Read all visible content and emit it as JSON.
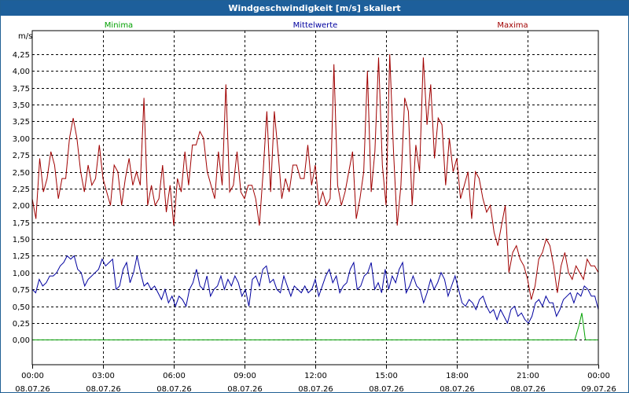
{
  "window": {
    "title": "Windgeschwindigkeit [m/s] skaliert"
  },
  "chart_data": {
    "type": "line",
    "title": "Windgeschwindigkeit [m/s] skaliert",
    "ylabel": "m/s",
    "ylim": [
      -0.37,
      4.6
    ],
    "xlim": [
      0,
      24
    ],
    "grid": true,
    "legend_placement": "top",
    "y_ticks": [
      "0,00",
      "0,25",
      "0,50",
      "0,75",
      "1,00",
      "1,25",
      "1,50",
      "1,75",
      "2,00",
      "2,25",
      "2,50",
      "2,75",
      "3,00",
      "3,25",
      "3,50",
      "3,75",
      "4,00",
      "4,25"
    ],
    "x_tick_labels": [
      {
        "time": "00:00",
        "date": "08.07.26"
      },
      {
        "time": "03:00",
        "date": "08.07.26"
      },
      {
        "time": "06:00",
        "date": "08.07.26"
      },
      {
        "time": "09:00",
        "date": "08.07.26"
      },
      {
        "time": "12:00",
        "date": "08.07.26"
      },
      {
        "time": "15:00",
        "date": "08.07.26"
      },
      {
        "time": "18:00",
        "date": "08.07.26"
      },
      {
        "time": "21:00",
        "date": "08.07.26"
      },
      {
        "time": "00:00",
        "date": "09.07.26"
      }
    ],
    "series": [
      {
        "name": "Minima",
        "color": "#00a000",
        "points": [
          [
            0,
            0
          ],
          [
            23,
            0
          ],
          [
            23.17,
            0.2
          ],
          [
            23.3,
            0.4
          ],
          [
            23.45,
            0
          ],
          [
            24,
            0
          ]
        ]
      },
      {
        "name": "Mittelwerte",
        "color": "#00009f",
        "values": [
          0.75,
          0.7,
          0.9,
          0.8,
          0.85,
          0.95,
          0.95,
          1.0,
          1.1,
          1.15,
          1.25,
          1.2,
          1.25,
          1.05,
          1.0,
          0.8,
          0.9,
          0.95,
          1.0,
          1.05,
          1.2,
          1.1,
          1.15,
          1.2,
          0.75,
          0.8,
          1.05,
          1.15,
          0.85,
          1.0,
          1.25,
          1.0,
          0.8,
          0.85,
          0.75,
          0.8,
          0.7,
          0.6,
          0.75,
          0.55,
          0.65,
          0.5,
          0.65,
          0.6,
          0.5,
          0.75,
          0.85,
          1.05,
          0.8,
          0.75,
          0.95,
          0.65,
          0.75,
          0.8,
          0.95,
          0.75,
          0.9,
          0.8,
          0.95,
          0.85,
          0.65,
          0.75,
          0.5,
          0.9,
          0.95,
          0.8,
          1.05,
          1.1,
          0.85,
          0.9,
          0.75,
          0.7,
          0.95,
          0.8,
          0.65,
          0.8,
          0.75,
          0.7,
          0.8,
          0.7,
          0.75,
          0.9,
          0.65,
          0.8,
          0.95,
          1.05,
          0.85,
          0.95,
          0.7,
          0.8,
          0.85,
          1.05,
          1.15,
          0.75,
          0.8,
          0.95,
          1.0,
          1.15,
          0.75,
          0.85,
          0.7,
          1.05,
          0.75,
          0.95,
          0.85,
          1.05,
          1.15,
          0.7,
          0.8,
          0.95,
          0.8,
          0.75,
          0.55,
          0.7,
          0.9,
          0.75,
          0.85,
          1.0,
          0.9,
          0.65,
          0.8,
          0.95,
          0.75,
          0.55,
          0.5,
          0.6,
          0.55,
          0.45,
          0.6,
          0.65,
          0.5,
          0.4,
          0.45,
          0.3,
          0.45,
          0.35,
          0.25,
          0.45,
          0.5,
          0.35,
          0.4,
          0.3,
          0.25,
          0.35,
          0.55,
          0.6,
          0.5,
          0.65,
          0.55,
          0.55,
          0.35,
          0.45,
          0.6,
          0.65,
          0.7,
          0.55,
          0.7,
          0.65,
          0.8,
          0.75,
          0.65,
          0.65,
          0.45
        ]
      },
      {
        "name": "Maxima",
        "color": "#a00000",
        "values": [
          2.1,
          1.8,
          2.7,
          2.2,
          2.4,
          2.8,
          2.6,
          2.1,
          2.4,
          2.4,
          3.0,
          3.3,
          3.0,
          2.5,
          2.2,
          2.6,
          2.3,
          2.4,
          2.9,
          2.4,
          2.2,
          2.0,
          2.6,
          2.5,
          2.0,
          2.4,
          2.7,
          2.3,
          2.5,
          2.3,
          3.6,
          2.0,
          2.3,
          2.0,
          2.1,
          2.6,
          1.9,
          2.3,
          1.7,
          2.4,
          2.2,
          2.8,
          2.3,
          2.9,
          2.9,
          3.1,
          3.0,
          2.5,
          2.3,
          2.1,
          2.8,
          2.3,
          3.8,
          2.2,
          2.3,
          2.8,
          2.2,
          2.1,
          2.3,
          2.3,
          2.1,
          1.7,
          2.5,
          3.4,
          2.2,
          3.4,
          2.8,
          2.1,
          2.4,
          2.2,
          2.6,
          2.6,
          2.4,
          2.4,
          2.9,
          2.3,
          2.6,
          2.0,
          2.2,
          2.0,
          2.1,
          4.1,
          2.3,
          2.0,
          2.2,
          2.5,
          2.8,
          1.8,
          2.1,
          2.5,
          4.0,
          2.2,
          2.8,
          4.2,
          2.6,
          2.0,
          4.25,
          2.8,
          1.7,
          2.3,
          3.6,
          3.4,
          2.0,
          2.9,
          2.5,
          4.2,
          3.2,
          3.8,
          2.7,
          3.3,
          3.2,
          2.3,
          3.0,
          2.5,
          2.7,
          2.1,
          2.3,
          2.5,
          1.8,
          2.5,
          2.4,
          2.1,
          1.9,
          2.0,
          1.6,
          1.4,
          1.7,
          2.0,
          1.0,
          1.3,
          1.4,
          1.2,
          1.1,
          0.9,
          0.6,
          0.8,
          1.2,
          1.3,
          1.5,
          1.4,
          1.1,
          0.7,
          1.1,
          1.3,
          1.0,
          0.9,
          1.1,
          1.0,
          0.9,
          1.2,
          1.1,
          1.1,
          1.0
        ]
      }
    ]
  }
}
